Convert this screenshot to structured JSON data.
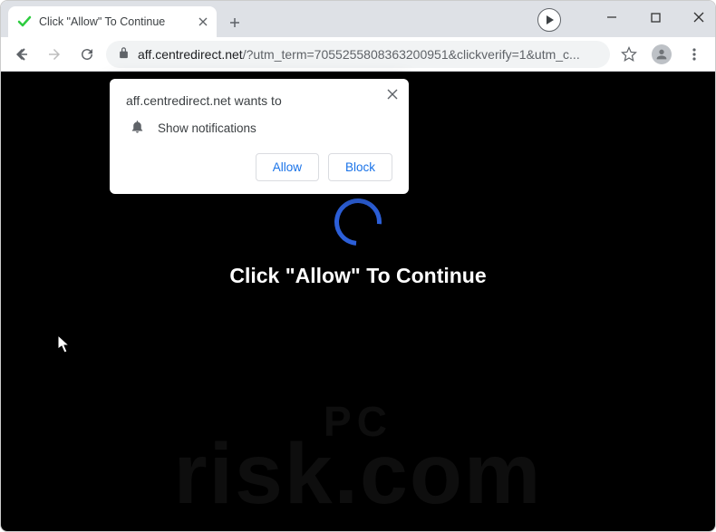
{
  "tab": {
    "title": "Click \"Allow\" To Continue"
  },
  "url": {
    "domain": "aff.centredirect.net",
    "rest": "/?utm_term=7055255808363200951&clickverify=1&utm_c..."
  },
  "notification": {
    "heading": "aff.centredirect.net wants to",
    "permission": "Show notifications",
    "allow": "Allow",
    "block": "Block"
  },
  "page": {
    "message": "Click \"Allow\" To Continue"
  },
  "watermark": {
    "top": "PC",
    "bottom": "risk.com"
  }
}
